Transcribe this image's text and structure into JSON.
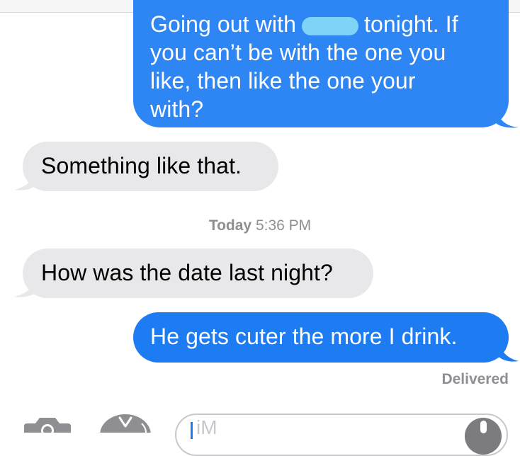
{
  "conversation": {
    "messages": [
      {
        "sender": "me",
        "lines": [
          "Going out with",
          "tonight. If",
          "you can’t be with the one you",
          "like, then like the one your",
          "with?"
        ]
      },
      {
        "sender": "them",
        "text": "Something like that."
      },
      {
        "sender": "them",
        "text": "How was the date last night?"
      },
      {
        "sender": "me",
        "text": "He gets cuter the more I drink."
      }
    ],
    "timestamp": {
      "day": "Today",
      "time": "5:36 PM"
    },
    "status": "Delivered"
  },
  "composer": {
    "placeholder": "iM"
  },
  "colors": {
    "sent_bubble": "#1e7cf2",
    "received_bubble": "#e8e8ea",
    "meta_text": "#8e8e93"
  },
  "icons": {
    "camera": "camera-icon",
    "apps": "app-store-icon",
    "mic": "microphone-icon"
  }
}
